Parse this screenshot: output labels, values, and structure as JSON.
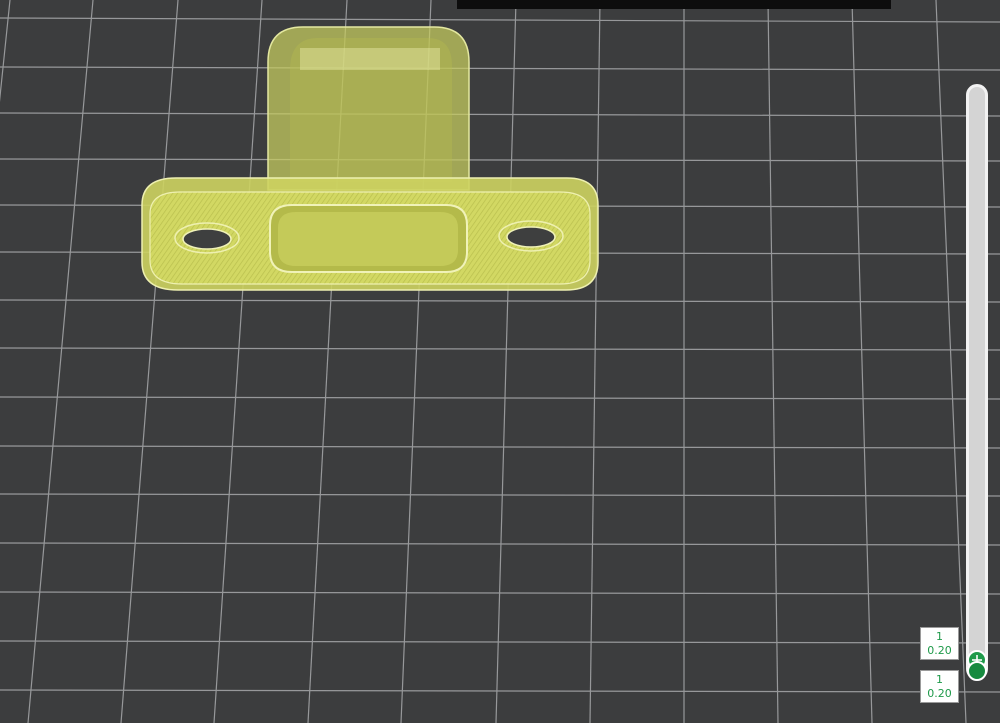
{
  "viewport": {
    "background_color": "#3c3d3e",
    "grid_color": "#a7a9ab",
    "model_color": "#d6dc6a"
  },
  "layer_slider": {
    "upper": {
      "layer": "1",
      "height": "0.20"
    },
    "lower": {
      "layer": "1",
      "height": "0.20"
    },
    "accent_color": "#1f9a4a"
  },
  "icons": {
    "add": "plus-icon"
  }
}
